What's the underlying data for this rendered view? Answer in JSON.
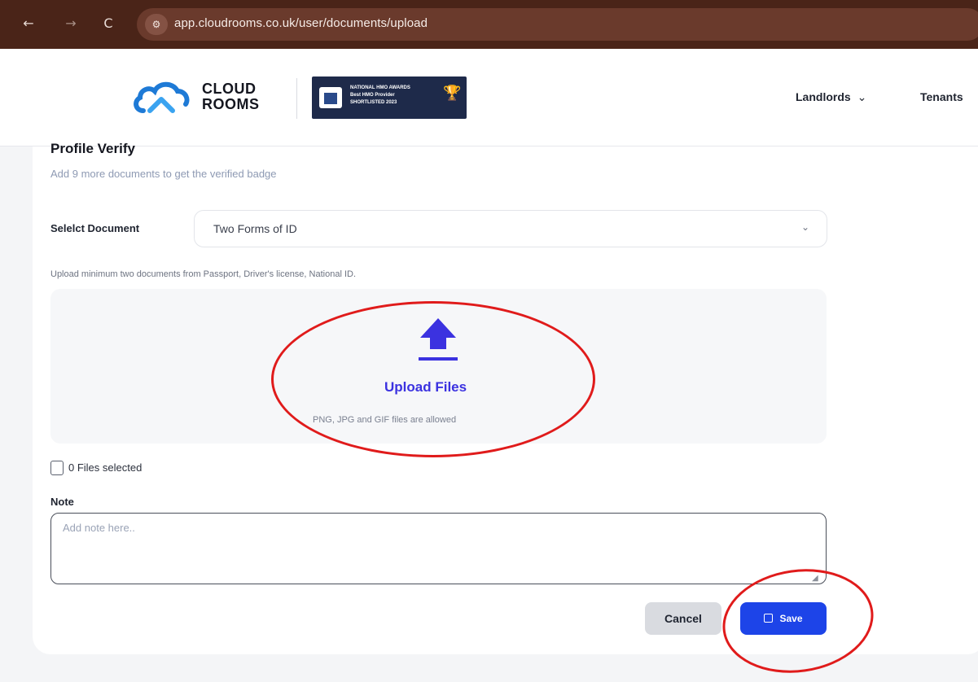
{
  "browser": {
    "back_glyph": "←",
    "forward_glyph": "→",
    "reload_glyph": "C",
    "site_info_glyph": "⚙",
    "url": "app.cloudrooms.co.uk/user/documents/upload"
  },
  "header": {
    "logo_line1": "CLOUD",
    "logo_line2": "ROOMS",
    "award_line1": "NATIONAL HMO AWARDS",
    "award_line2": "Best HMO Provider",
    "award_line3": "SHORTLISTED 2023",
    "nav": {
      "landlords": "Landlords",
      "tenants": "Tenants"
    },
    "chevron": "⌄"
  },
  "profile": {
    "title": "Profile Verify",
    "subtitle": "Add 9 more documents to get the verified badge"
  },
  "document_select": {
    "label": "Selelct Document",
    "value": "Two Forms of ID",
    "chevron": "⌄"
  },
  "hint": "Upload minimum two documents from Passport, Driver's license, National ID.",
  "upload": {
    "title": "Upload Files",
    "subtitle": "PNG, JPG and GIF files are allowed"
  },
  "files": {
    "count_text": "0 Files selected"
  },
  "note": {
    "label": "Note",
    "placeholder": "Add note here.."
  },
  "actions": {
    "cancel": "Cancel",
    "save": "Save"
  },
  "colors": {
    "accent": "#1d44e8",
    "upload_title": "#3b32e0",
    "annotation": "#e01b1b",
    "browser_bar": "#4a2418"
  }
}
